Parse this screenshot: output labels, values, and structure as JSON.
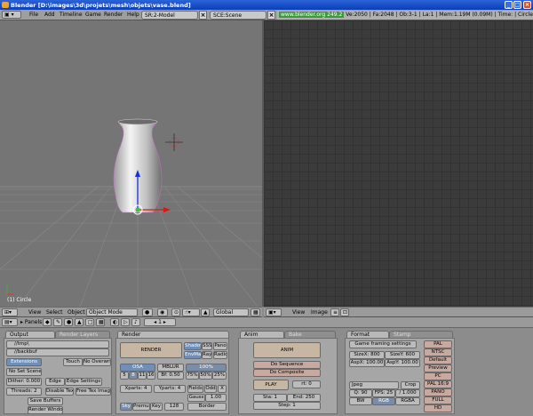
{
  "window": {
    "title": "Blender [D:\\images\\3d\\projets\\mesh\\objets\\vase.blend]"
  },
  "info": {
    "menus": [
      "File",
      "Add",
      "Timeline",
      "Game",
      "Render",
      "Help"
    ],
    "screen": "SR:2-Model",
    "scene": "SCE:Scene",
    "url": "www.blender.org 249.2",
    "stats": "Ve:2050 | Fa:2048 | Ob:3-1 | La:1 | Mem:1.19M (0.09M) | Time: | Circle"
  },
  "viewport": {
    "info": "(1) Circle"
  },
  "view3d_header": {
    "menus": [
      "View",
      "Select",
      "Object"
    ],
    "mode": "Object Mode",
    "orientation": "Global"
  },
  "image_header": {
    "menus": [
      "View",
      "Image"
    ]
  },
  "buttons_header": {
    "label": "Panels",
    "frame": "1"
  },
  "output_panel": {
    "tabs": [
      "Output",
      "Render Layers"
    ],
    "paths": [
      "//tmp\\",
      "//backbuf"
    ],
    "extensions": "Extensions",
    "touch": "Touch",
    "no_overwrite": "No Overwrite",
    "no_set_scene": "No Set Scene",
    "dither": "Dither: 0.000",
    "edge": "Edge",
    "edge_settings": "Edge Settings",
    "threads": "Threads: 2",
    "disable_tex": "Disable Tex",
    "free_tex": "Free Tex Images",
    "save_buffers": "Save Buffers",
    "render_window": "Render Window"
  },
  "render_panel": {
    "tab": "Render",
    "render": "RENDER",
    "shadow": "Shadow",
    "sss": "SSS",
    "pano": "Pano",
    "envmap": "EnvMa",
    "ray": "Ray",
    "radio": "Radio",
    "osa": "OSA",
    "mblur": "MBLUR",
    "percent100": "100%",
    "osa_vals": [
      "5",
      "8",
      "11",
      "16"
    ],
    "bf": "Bf: 0.50",
    "percents": [
      "75%",
      "50%",
      "25%"
    ],
    "xparts": "Xparts: 4",
    "yparts": "Yparts: 4",
    "fields": "Fields",
    "odd": "Odd",
    "x": "X",
    "gauss": "Gauss",
    "gauss_val": "1.00",
    "sky": "Sky",
    "premul": "Premul",
    "key": "Key",
    "num128": "128",
    "border": "Border"
  },
  "anim_panel": {
    "tabs": [
      "Anim",
      "Bake"
    ],
    "anim": "ANIM",
    "do_sequence": "Do Sequence",
    "do_composite": "Do Composite",
    "play": "PLAY",
    "rt": "rt: 0",
    "sta": "Sta: 1",
    "end": "End: 250",
    "step": "Step: 1"
  },
  "format_panel": {
    "tabs": [
      "Format",
      "Stamp"
    ],
    "game_framing": "Game framing settings",
    "sizex": "SizeX: 800",
    "sizey": "SizeY: 600",
    "aspx": "AspX: 100.00",
    "aspy": "AspY: 100.00",
    "jpeg": "Jpeg",
    "crop": "Crop",
    "q": "Q: 90",
    "fps": "FPS: 25",
    "fps_div": "/ 1.000",
    "bw": "BW",
    "rgb": "RGB",
    "rgba": "RGBA",
    "presets": [
      "PAL",
      "NTSC",
      "Default",
      "Preview",
      "PC",
      "PAL 16:9",
      "PANO",
      "FULL",
      "HD"
    ]
  }
}
